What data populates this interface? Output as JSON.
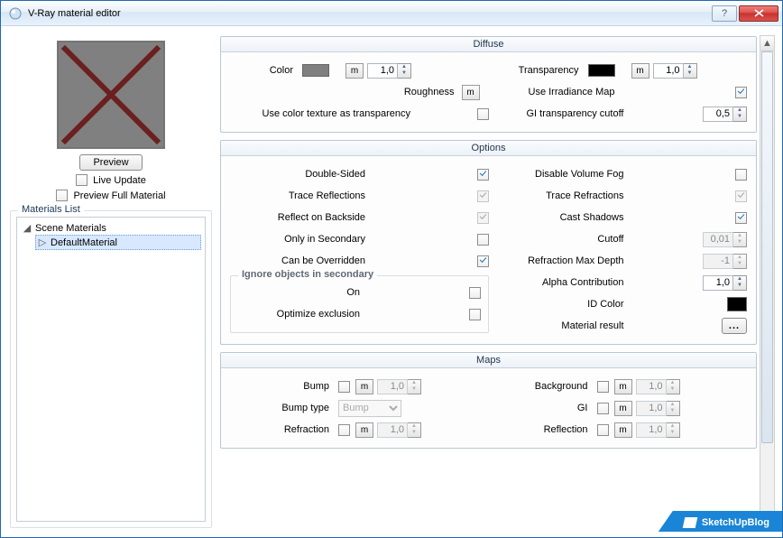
{
  "window": {
    "title": "V-Ray material editor"
  },
  "preview": {
    "button": "Preview",
    "live_update": "Live Update",
    "preview_full": "Preview Full Material"
  },
  "materials_list": {
    "title": "Materials List",
    "root": "Scene Materials",
    "items": [
      "DefaultMaterial"
    ]
  },
  "sections": {
    "diffuse": {
      "title": "Diffuse",
      "color_label": "Color",
      "color_value": "#808080",
      "color_m": "m",
      "color_amount": "1,0",
      "transparency_label": "Transparency",
      "transparency_value": "#000000",
      "transparency_m": "m",
      "transparency_amount": "1,0",
      "roughness_label": "Roughness",
      "roughness_m": "m",
      "irradiance_label": "Use Irradiance Map",
      "tex_as_transparency_label": "Use color texture as transparency",
      "gi_cutoff_label": "GI transparency cutoff",
      "gi_cutoff_value": "0,5"
    },
    "options": {
      "title": "Options",
      "left": {
        "double_sided": "Double-Sided",
        "trace_reflections": "Trace Reflections",
        "reflect_backside": "Reflect on Backside",
        "only_secondary": "Only in Secondary",
        "can_override": "Can be Overridden",
        "ignore_group": "Ignore objects in secondary",
        "ignore_on": "On",
        "optimize_exclusion": "Optimize exclusion"
      },
      "right": {
        "disable_vol_fog": "Disable Volume Fog",
        "trace_refractions": "Trace Refractions",
        "cast_shadows": "Cast Shadows",
        "cutoff_label": "Cutoff",
        "cutoff_value": "0,01",
        "refr_max_depth_label": "Refraction Max Depth",
        "refr_max_depth_value": "-1",
        "alpha_label": "Alpha Contribution",
        "alpha_value": "1,0",
        "id_color_label": "ID Color",
        "id_color_value": "#000000",
        "mat_result_label": "Material result",
        "mat_result_btn": "..."
      }
    },
    "maps": {
      "title": "Maps",
      "bump_label": "Bump",
      "bump_m": "m",
      "bump_value": "1,0",
      "bump_type_label": "Bump type",
      "bump_type_value": "Bump",
      "refraction_label": "Refraction",
      "refraction_m": "m",
      "refraction_value": "1,0",
      "background_label": "Background",
      "background_m": "m",
      "background_value": "1,0",
      "gi_label": "GI",
      "gi_m": "m",
      "gi_value": "1,0",
      "reflection_label": "Reflection",
      "reflection_m": "m",
      "reflection_value": "1,0"
    }
  },
  "watermark": "SketchUpBlog"
}
